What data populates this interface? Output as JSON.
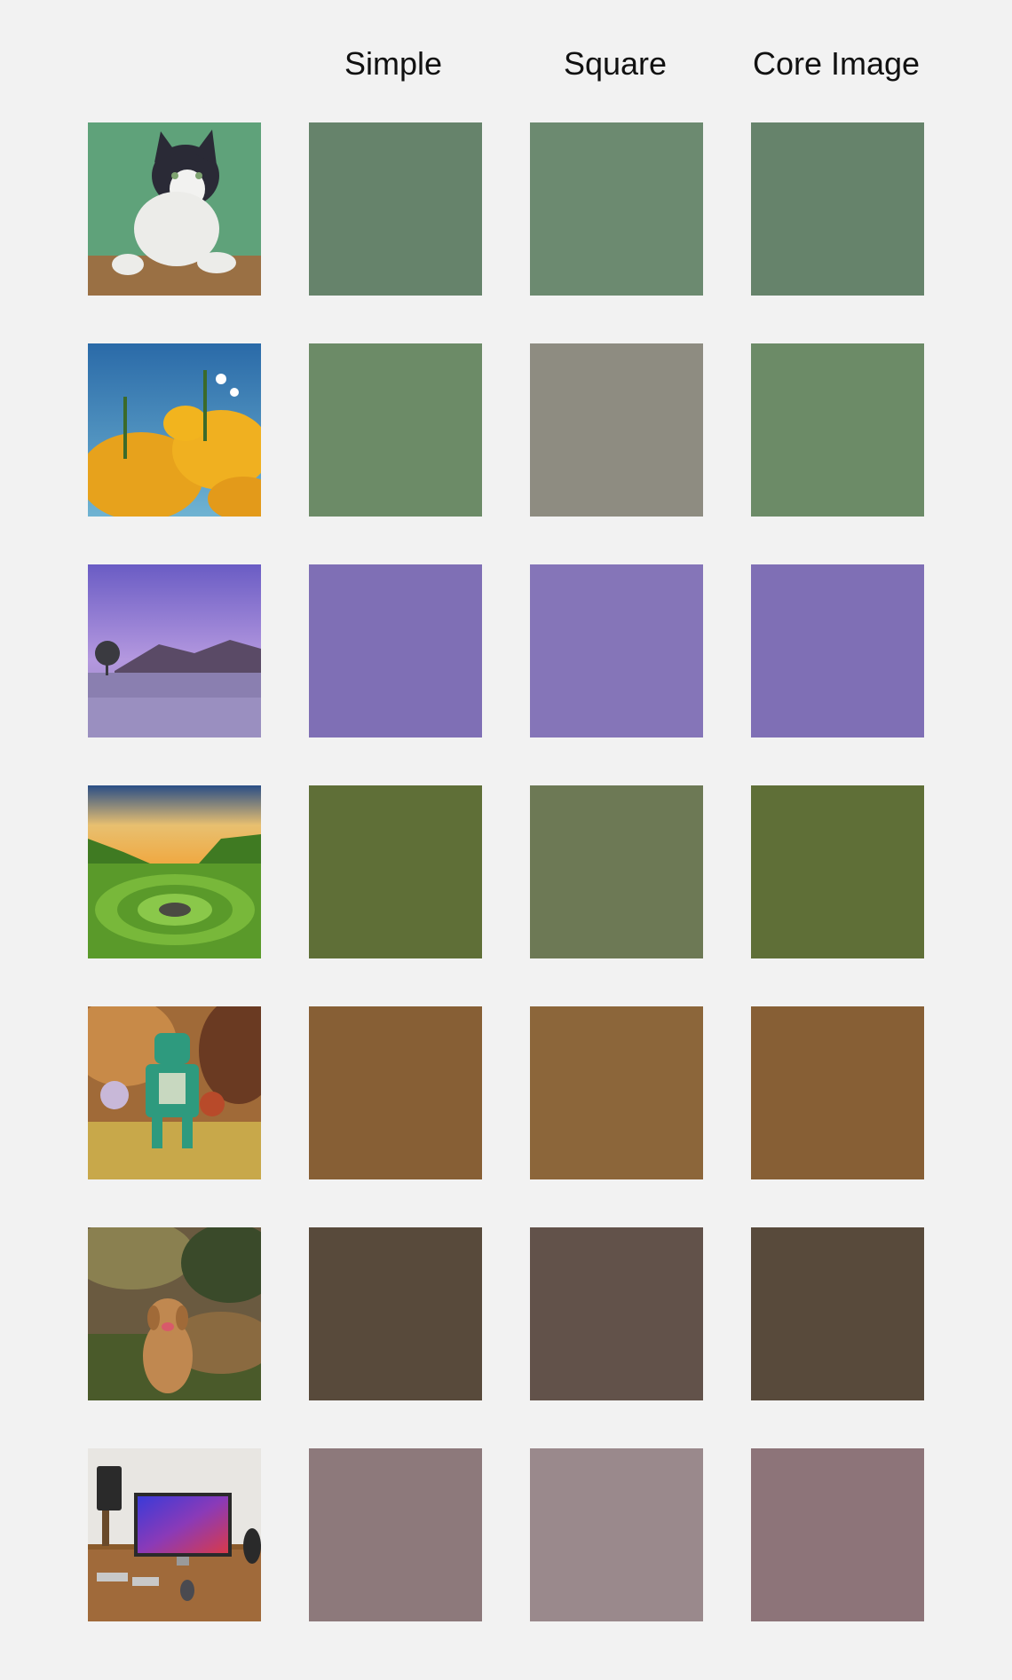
{
  "columns": {
    "source": "",
    "simple": "Simple",
    "square": "Square",
    "core_image": "Core Image"
  },
  "rows": [
    {
      "subject": "cat",
      "icon": "cat-photo",
      "simple": "#66836b",
      "square": "#6c8a70",
      "core_image": "#66836b"
    },
    {
      "subject": "flowers",
      "icon": "flowers-photo",
      "simple": "#6c8b67",
      "square": "#8e8c81",
      "core_image": "#6c8b67"
    },
    {
      "subject": "lake",
      "icon": "lake-photo",
      "simple": "#7f6fb5",
      "square": "#8575b8",
      "core_image": "#7f6fb5"
    },
    {
      "subject": "landscape",
      "icon": "landscape-photo",
      "simple": "#5f6f37",
      "square": "#6d7955",
      "core_image": "#5f6f37"
    },
    {
      "subject": "robot",
      "icon": "robot-photo",
      "simple": "#875f35",
      "square": "#8c663a",
      "core_image": "#875f35"
    },
    {
      "subject": "dog",
      "icon": "dog-photo",
      "simple": "#584a3b",
      "square": "#62524a",
      "core_image": "#584a3b"
    },
    {
      "subject": "desk",
      "icon": "desk-photo",
      "simple": "#8d797b",
      "square": "#9a898c",
      "core_image": "#8d7479"
    }
  ]
}
